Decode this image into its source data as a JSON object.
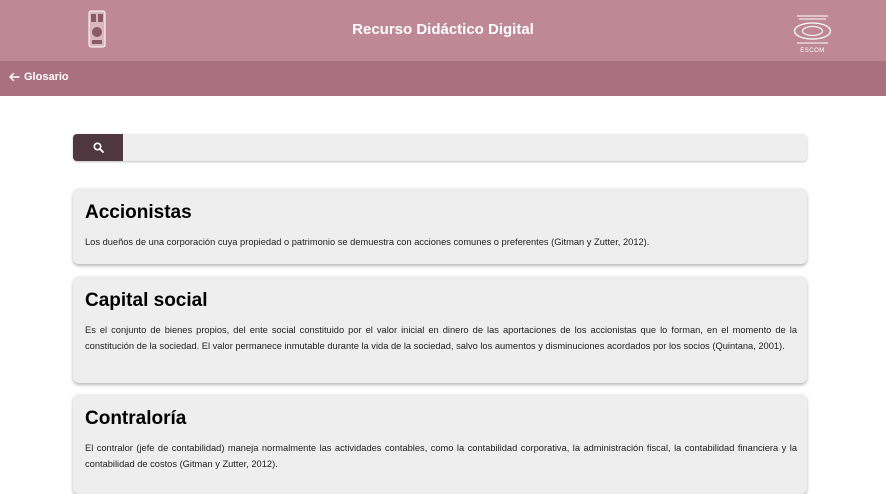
{
  "header": {
    "title": "Recurso Didáctico Digital",
    "right_logo_text": "ESCOM",
    "background": "#be8995"
  },
  "navbar": {
    "title": "Glosario",
    "background": "#a9717f"
  },
  "search": {
    "placeholder": "",
    "value": "",
    "button_color": "#4f3740"
  },
  "entries": [
    {
      "term": "Accionistas",
      "definition": "Los dueños de una corporación cuya propiedad o patrimonio se demuestra con acciones comunes o preferentes (Gitman y Zutter, 2012)."
    },
    {
      "term": "Capital social",
      "definition": "Es el conjunto de bienes propios, del ente social constituido por el valor inicial en dinero de las aportaciones de los accionistas que lo forman, en el momento de la constitución de la sociedad. El valor permanece inmutable durante la vida de la sociedad, salvo los aumentos y disminuciones acordados por los socios (Quintana, 2001)."
    },
    {
      "term": "Contraloría",
      "definition": "El contralor (jefe de contabilidad) maneja normalmente las actividades contables, como la contabilidad corporativa, la administración fiscal, la contabilidad financiera y la contabilidad de costos (Gitman y Zutter, 2012)."
    }
  ]
}
